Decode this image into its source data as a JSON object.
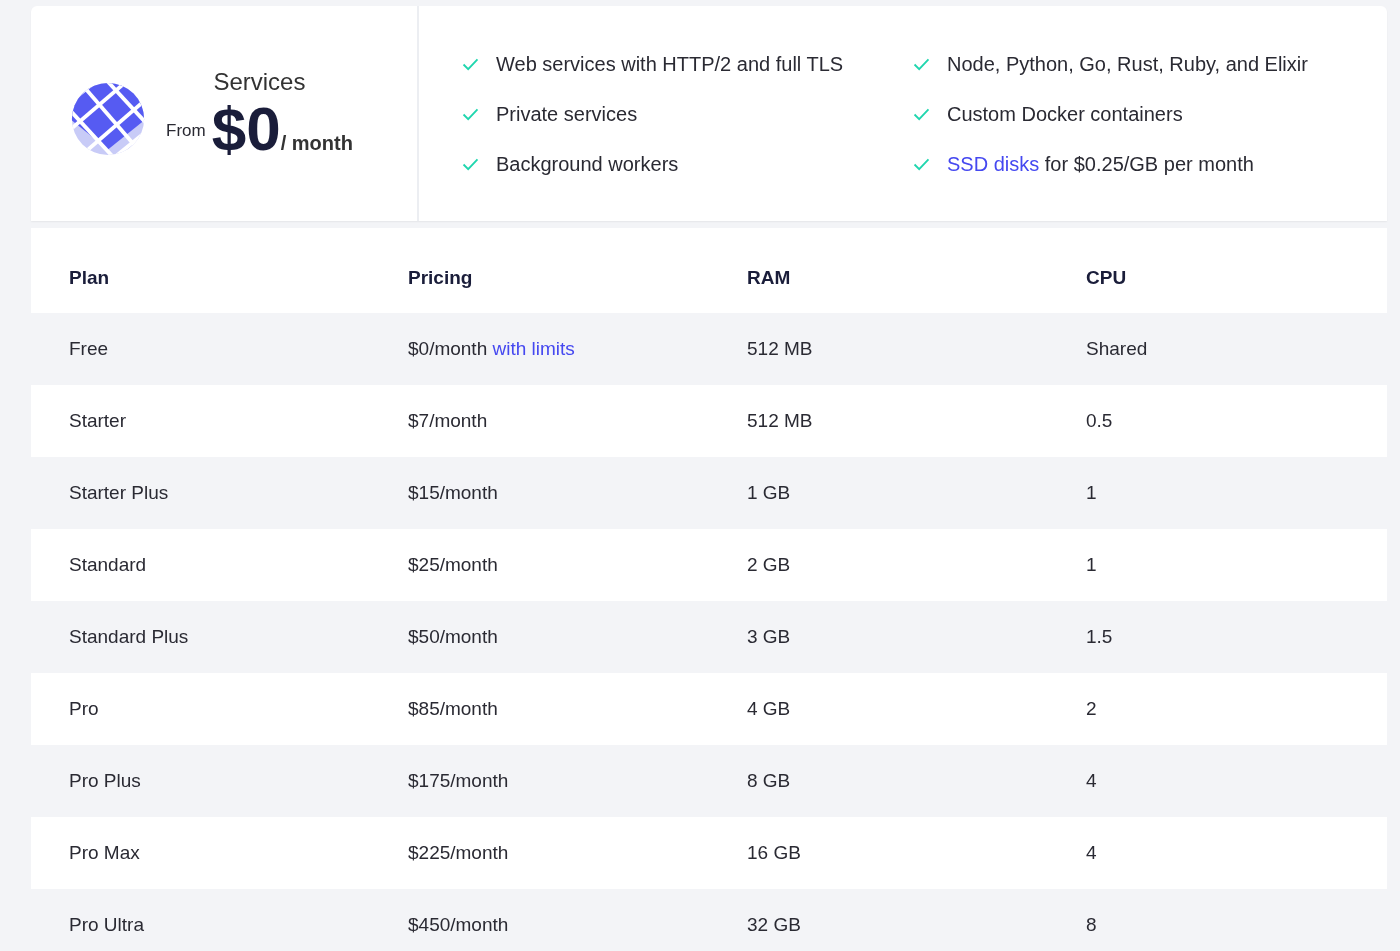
{
  "product": {
    "title": "Services",
    "price_prefix": "From",
    "price": "$0",
    "price_suffix": "/ month"
  },
  "features": [
    {
      "parts": [
        {
          "text": "Web services with HTTP/2 and full TLS",
          "link": false
        }
      ]
    },
    {
      "parts": [
        {
          "text": "Node, Python, Go, Rust, Ruby, and Elixir",
          "link": false
        }
      ]
    },
    {
      "parts": [
        {
          "text": "Private services",
          "link": false
        }
      ]
    },
    {
      "parts": [
        {
          "text": "Custom Docker containers",
          "link": false
        }
      ]
    },
    {
      "parts": [
        {
          "text": "Background workers",
          "link": false
        }
      ]
    },
    {
      "parts": [
        {
          "text": "SSD disks",
          "link": true
        },
        {
          "text": " for $0.25/GB per month",
          "link": false
        }
      ]
    }
  ],
  "table": {
    "columns": [
      "Plan",
      "Pricing",
      "RAM",
      "CPU"
    ],
    "rows": [
      [
        [
          {
            "text": "Free",
            "link": false
          }
        ],
        [
          {
            "text": "$0/month ",
            "link": false
          },
          {
            "text": "with limits",
            "link": true
          }
        ],
        [
          {
            "text": "512 MB",
            "link": false
          }
        ],
        [
          {
            "text": "Shared",
            "link": false
          }
        ]
      ],
      [
        [
          {
            "text": "Starter",
            "link": false
          }
        ],
        [
          {
            "text": "$7/month",
            "link": false
          }
        ],
        [
          {
            "text": "512 MB",
            "link": false
          }
        ],
        [
          {
            "text": "0.5",
            "link": false
          }
        ]
      ],
      [
        [
          {
            "text": "Starter Plus",
            "link": false
          }
        ],
        [
          {
            "text": "$15/month",
            "link": false
          }
        ],
        [
          {
            "text": "1 GB",
            "link": false
          }
        ],
        [
          {
            "text": "1",
            "link": false
          }
        ]
      ],
      [
        [
          {
            "text": "Standard",
            "link": false
          }
        ],
        [
          {
            "text": "$25/month",
            "link": false
          }
        ],
        [
          {
            "text": "2 GB",
            "link": false
          }
        ],
        [
          {
            "text": "1",
            "link": false
          }
        ]
      ],
      [
        [
          {
            "text": "Standard Plus",
            "link": false
          }
        ],
        [
          {
            "text": "$50/month",
            "link": false
          }
        ],
        [
          {
            "text": "3 GB",
            "link": false
          }
        ],
        [
          {
            "text": "1.5",
            "link": false
          }
        ]
      ],
      [
        [
          {
            "text": "Pro",
            "link": false
          }
        ],
        [
          {
            "text": "$85/month",
            "link": false
          }
        ],
        [
          {
            "text": "4 GB",
            "link": false
          }
        ],
        [
          {
            "text": "2",
            "link": false
          }
        ]
      ],
      [
        [
          {
            "text": "Pro Plus",
            "link": false
          }
        ],
        [
          {
            "text": "$175/month",
            "link": false
          }
        ],
        [
          {
            "text": "8 GB",
            "link": false
          }
        ],
        [
          {
            "text": "4",
            "link": false
          }
        ]
      ],
      [
        [
          {
            "text": "Pro Max",
            "link": false
          }
        ],
        [
          {
            "text": "$225/month",
            "link": false
          }
        ],
        [
          {
            "text": "16 GB",
            "link": false
          }
        ],
        [
          {
            "text": "4",
            "link": false
          }
        ]
      ],
      [
        [
          {
            "text": "Pro Ultra",
            "link": false
          }
        ],
        [
          {
            "text": "$450/month",
            "link": false
          }
        ],
        [
          {
            "text": "32 GB",
            "link": false
          }
        ],
        [
          {
            "text": "8",
            "link": false
          }
        ]
      ]
    ]
  }
}
